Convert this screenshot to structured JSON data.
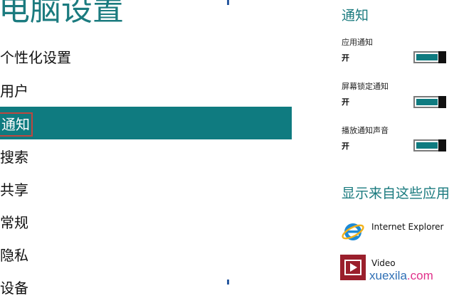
{
  "nav": {
    "title": "电脑设置",
    "items": [
      {
        "label": "个性化设置"
      },
      {
        "label": "用户"
      },
      {
        "label": "通知"
      },
      {
        "label": "搜索"
      },
      {
        "label": "共享"
      },
      {
        "label": "常规"
      },
      {
        "label": "隐私"
      },
      {
        "label": "设备"
      }
    ],
    "selected": "通知"
  },
  "notifications": {
    "title": "通知",
    "settings": [
      {
        "label": "应用通知",
        "state": "开",
        "on": true
      },
      {
        "label": "屏幕锁定通知",
        "state": "开",
        "on": true
      },
      {
        "label": "播放通知声音",
        "state": "开",
        "on": true
      }
    ]
  },
  "apps": {
    "title": "显示来自这些应用",
    "items": [
      {
        "name": "Internet Explorer",
        "icon": "internet-explorer-icon"
      },
      {
        "name": "Video",
        "icon": "video-icon"
      }
    ]
  },
  "watermark": {
    "text": "xuexila",
    "suffix": ".com"
  },
  "colors": {
    "accent": "#0f7b80",
    "title": "#1b7b7f",
    "selection_outline": "#c0463e",
    "toggle_thumb": "#111111",
    "ie_blue": "#1d8ad6",
    "video_red": "#9a1f2c"
  }
}
